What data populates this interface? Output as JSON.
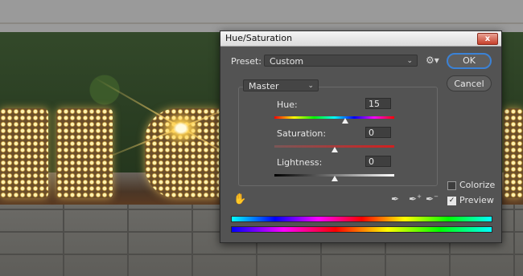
{
  "dialog": {
    "title": "Hue/Saturation",
    "close_label": "x",
    "preset_label": "Preset:",
    "preset_value": "Custom",
    "ok_label": "OK",
    "cancel_label": "Cancel",
    "channel_value": "Master",
    "hue": {
      "label": "Hue:",
      "value": "15",
      "slider_fraction": 0.59
    },
    "saturation": {
      "label": "Saturation:",
      "value": "0",
      "slider_fraction": 0.5
    },
    "lightness": {
      "label": "Lightness:",
      "value": "0",
      "slider_fraction": 0.5
    },
    "colorize_label": "Colorize",
    "colorize_checked": false,
    "preview_label": "Preview",
    "preview_checked": true
  },
  "icons": {
    "gear": "gear-icon",
    "hand": "targeted-adjustment-icon",
    "eyedropper": "eyedropper-icon",
    "eyedropper_plus": "eyedropper-add-icon",
    "eyedropper_minus": "eyedropper-subtract-icon"
  },
  "colors": {
    "accent": "#3b82d6",
    "dialog_bg": "#535353"
  }
}
